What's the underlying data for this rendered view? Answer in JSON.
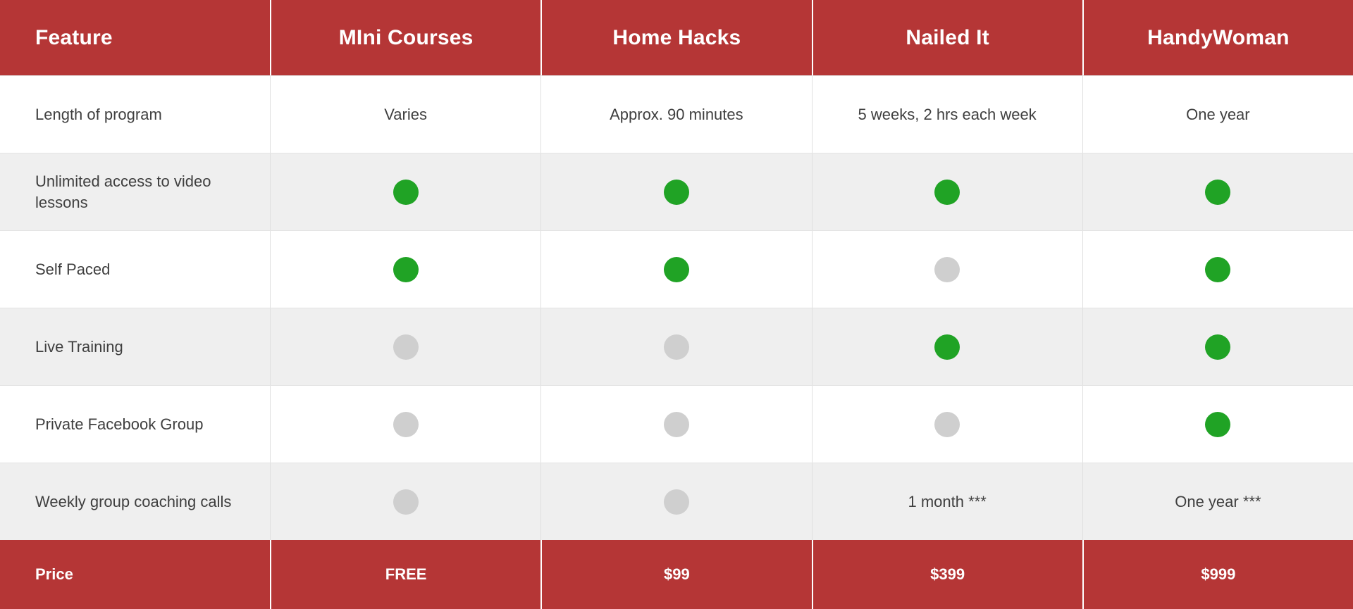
{
  "table": {
    "columns": [
      {
        "key": "feature",
        "label": "Feature"
      },
      {
        "key": "mini",
        "label": "MIni Courses"
      },
      {
        "key": "hacks",
        "label": "Home Hacks"
      },
      {
        "key": "nailed",
        "label": "Nailed It"
      },
      {
        "key": "handy",
        "label": "HandyWoman"
      }
    ],
    "rows": [
      {
        "feature": "Length of program",
        "values": [
          "Varies",
          "Approx. 90 minutes",
          "5 weeks, 2 hrs each week",
          "One year"
        ],
        "types": [
          "text",
          "text",
          "text",
          "text"
        ],
        "stripe": false
      },
      {
        "feature": "Unlimited access to video lessons",
        "values": [
          "yes",
          "yes",
          "yes",
          "yes"
        ],
        "types": [
          "dot",
          "dot",
          "dot",
          "dot"
        ],
        "stripe": true
      },
      {
        "feature": "Self Paced",
        "values": [
          "yes",
          "yes",
          "no",
          "yes"
        ],
        "types": [
          "dot",
          "dot",
          "dot",
          "dot"
        ],
        "stripe": false
      },
      {
        "feature": "Live Training",
        "values": [
          "no",
          "no",
          "yes",
          "yes"
        ],
        "types": [
          "dot",
          "dot",
          "dot",
          "dot"
        ],
        "stripe": true
      },
      {
        "feature": "Private Facebook Group",
        "values": [
          "no",
          "no",
          "no",
          "yes"
        ],
        "types": [
          "dot",
          "dot",
          "dot",
          "dot"
        ],
        "stripe": false
      },
      {
        "feature": "Weekly group coaching calls",
        "values": [
          "no",
          "no",
          "1 month ***",
          "One year ***"
        ],
        "types": [
          "dot",
          "dot",
          "text",
          "text"
        ],
        "stripe": true
      }
    ],
    "footer": {
      "label": "Price",
      "values": [
        "FREE",
        "$99",
        "$399",
        "$999"
      ]
    }
  },
  "icons": {
    "included": "filled-circle-icon",
    "excluded": "filled-circle-icon"
  },
  "colors": {
    "header_red": "#b53636",
    "included_green": "#20a325",
    "excluded_gray": "#cfcfcf",
    "stripe_gray": "#efefef",
    "text_dark": "#3f3f3f",
    "header_text": "#ffffff"
  }
}
